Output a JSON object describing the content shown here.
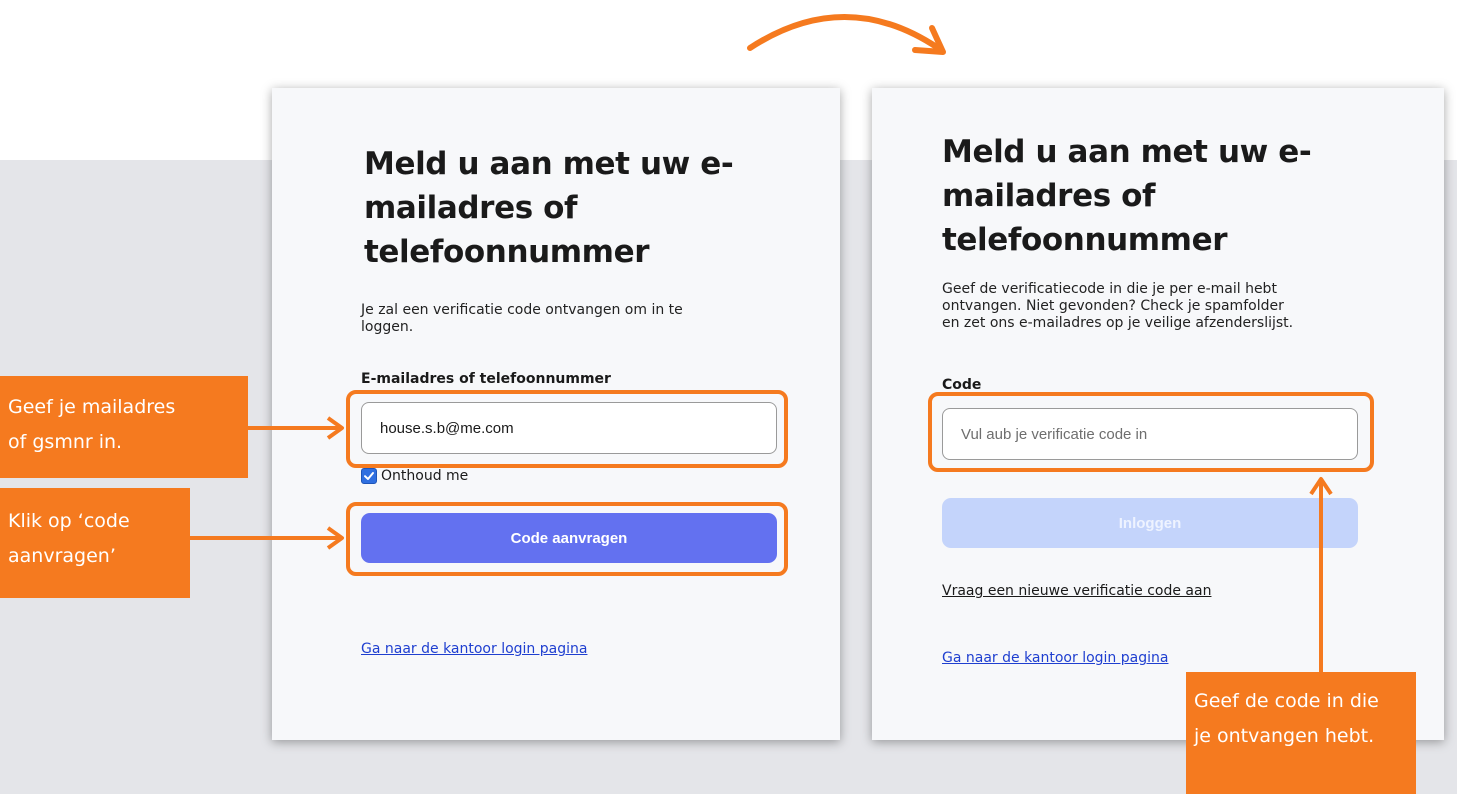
{
  "colors": {
    "accent": "#f57a1f",
    "primary_button": "#6371f0",
    "disabled_button": "#c4d4fb",
    "link": "#1f3fd0",
    "background_band": "#e4e5e9"
  },
  "left_panel": {
    "title": "Meld u aan met uw e-mailadres of telefoonnummer",
    "title_lines": [
      "Meld u aan met uw e-",
      "mailadres of",
      "telefoonnummer"
    ],
    "description_lines": [
      "Je zal een verificatie code ontvangen om in te",
      "loggen."
    ],
    "field_label": "E-mailadres of telefoonnummer",
    "input_value": "house.s.b@me.com",
    "remember_label": "Onthoud me",
    "remember_checked": true,
    "submit_label": "Code aanvragen",
    "office_link": "Ga naar de kantoor login pagina"
  },
  "right_panel": {
    "title_lines": [
      "Meld u aan met uw e-",
      "mailadres of",
      "telefoonnummer"
    ],
    "description_lines": [
      "Geef de verificatiecode in die je per e-mail hebt",
      "ontvangen. Niet gevonden? Check je spamfolder",
      "en zet ons e-mailadres op je veilige afzenderslijst."
    ],
    "field_label": "Code",
    "input_placeholder": "Vul aub je verificatie code in",
    "login_label": "Inloggen",
    "new_code_link": "Vraag een nieuwe verificatie code aan",
    "office_link": "Ga naar de kantoor login pagina"
  },
  "callouts": {
    "email": [
      "Geef je mailadres",
      "of gsmnr in."
    ],
    "request": [
      "Klik op ‘code",
      "aanvragen’"
    ],
    "code": [
      "Geef de code in die",
      "je ontvangen hebt."
    ]
  },
  "icons": {
    "flow_arrow": "curved-arrow-icon",
    "pointer_arrow": "arrow-icon",
    "checkbox": "checkbox-checked-icon"
  }
}
